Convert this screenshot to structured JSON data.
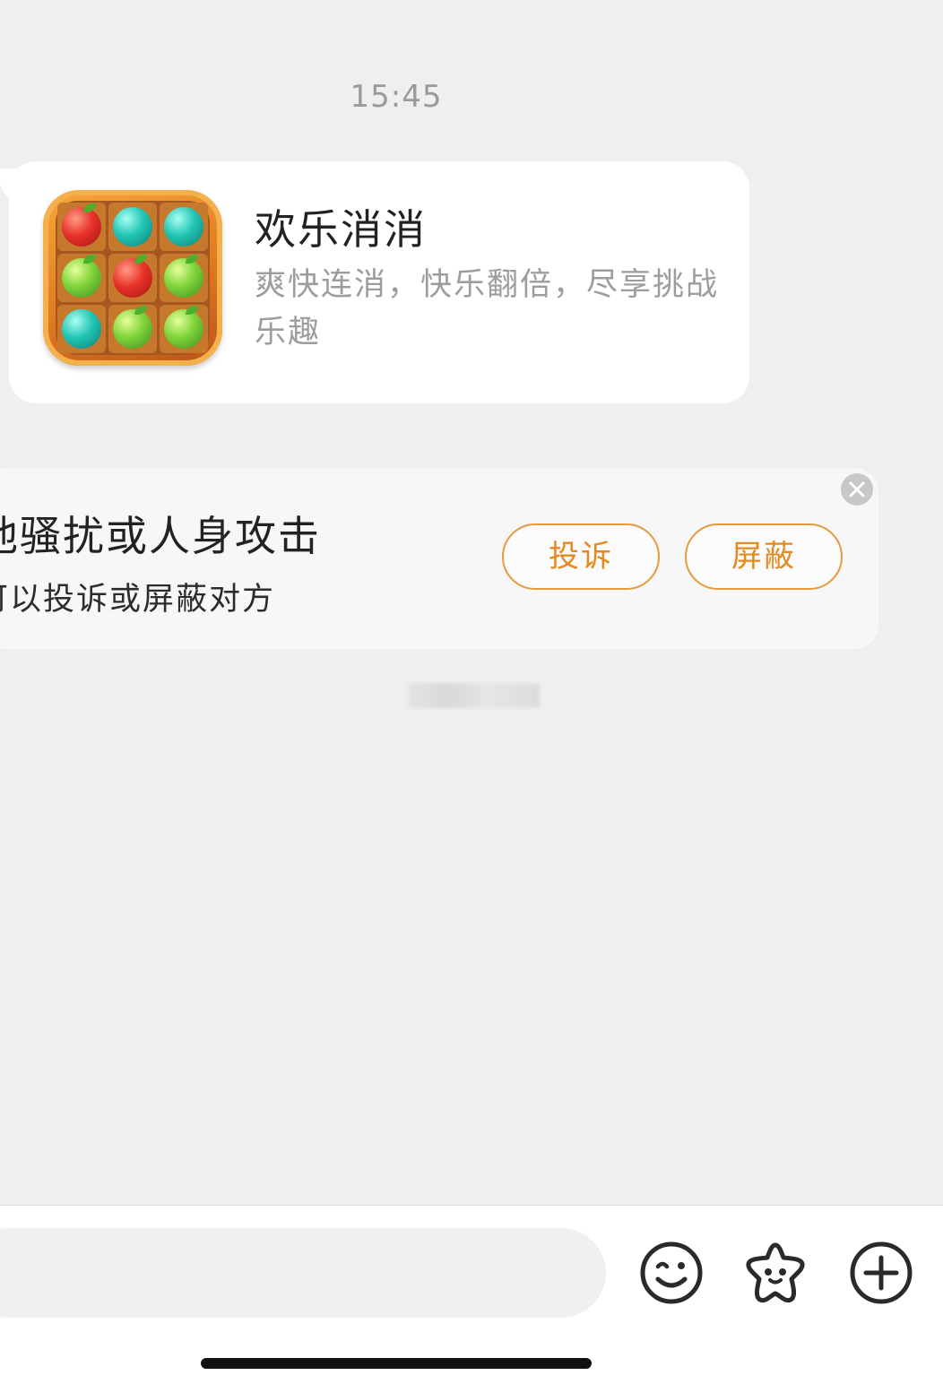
{
  "chat": {
    "timestamp": "15:45"
  },
  "game_card": {
    "title": "欢乐消消",
    "description": "爽快连消，快乐翻倍，尽享挑战乐趣",
    "icon": "fruit-match-game-icon"
  },
  "safety_notice": {
    "line1": "他骚扰或人身攻击",
    "line2": "可以投诉或屏蔽对方",
    "complain_label": "投诉",
    "block_label": "屏蔽",
    "accent_color": "#e58a1f"
  },
  "input_bar": {
    "placeholder": "",
    "emoji_icon": "emoji-face-icon",
    "sticker_icon": "star-sticker-icon",
    "plus_icon": "plus-circle-icon"
  }
}
